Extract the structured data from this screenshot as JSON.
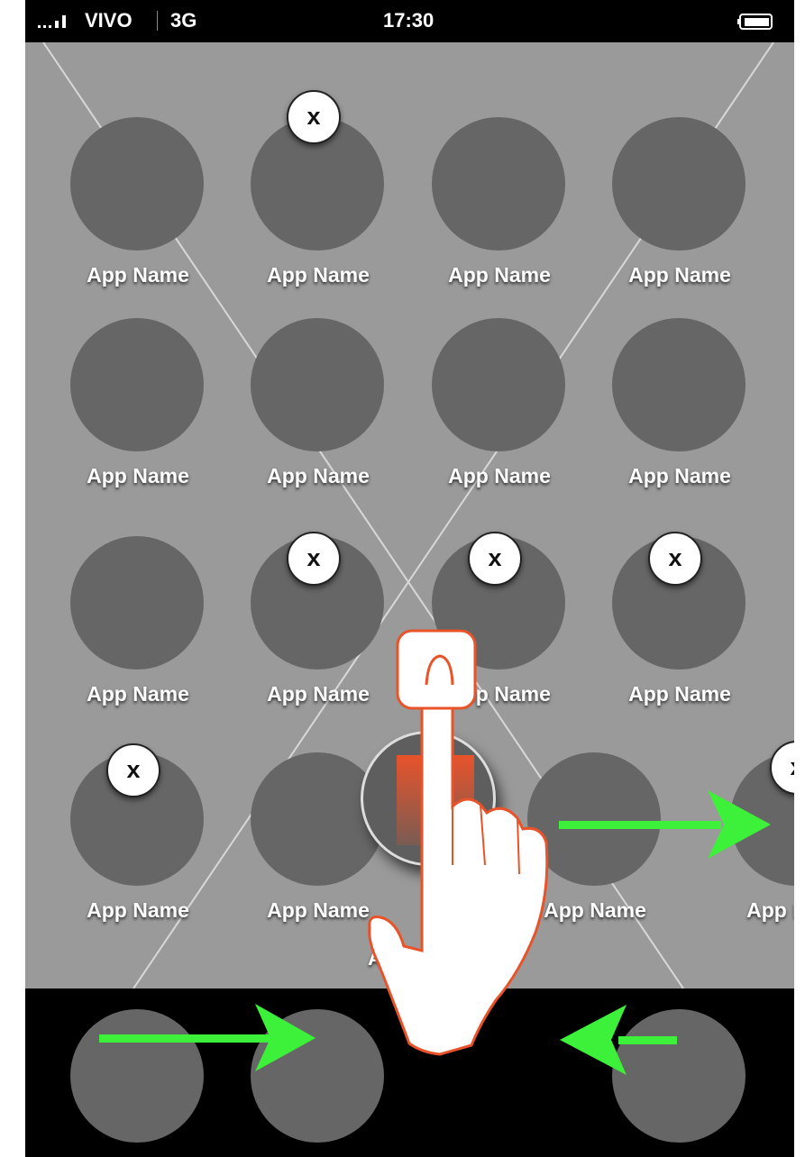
{
  "status_bar": {
    "carrier": "VIVO",
    "network": "3G",
    "time": "17:30"
  },
  "apps": [
    {
      "label": "App Name",
      "delete": false
    },
    {
      "label": "App Name",
      "delete": true
    },
    {
      "label": "App Name",
      "delete": false
    },
    {
      "label": "App Name",
      "delete": false
    },
    {
      "label": "App Name",
      "delete": false
    },
    {
      "label": "App Name",
      "delete": false
    },
    {
      "label": "App Name",
      "delete": false
    },
    {
      "label": "App Name",
      "delete": false
    },
    {
      "label": "App Name",
      "delete": false
    },
    {
      "label": "App Name",
      "delete": true
    },
    {
      "label": "App Name",
      "delete": true
    },
    {
      "label": "App Name",
      "delete": true
    },
    {
      "label": "App Name",
      "delete": true
    },
    {
      "label": "App Name",
      "delete": false
    },
    {
      "label": "App Name",
      "delete": false
    },
    {
      "label": "App Name",
      "delete": true
    }
  ],
  "delete_glyph": "x",
  "dock_icons": 3,
  "colors": {
    "arrow": "#3df03a",
    "finger_trail": "#e8532a",
    "icon": "#666666",
    "background": "#999999"
  }
}
